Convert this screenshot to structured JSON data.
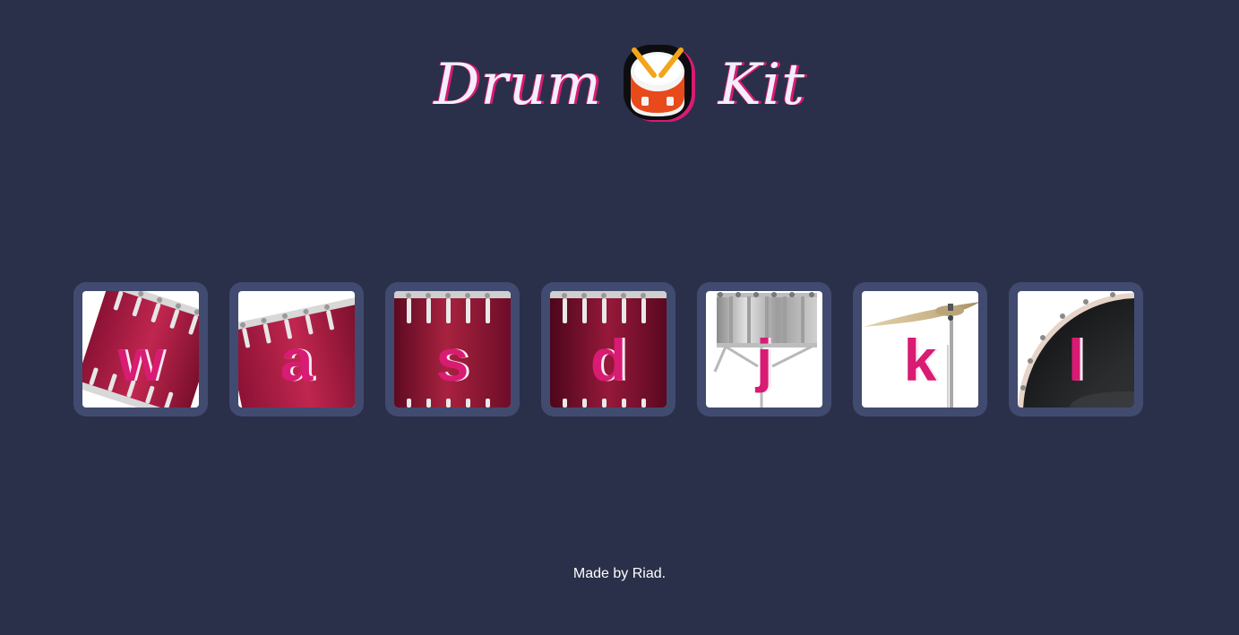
{
  "title": {
    "left_word": "Drum",
    "right_word": "Kit",
    "emoji_icon": "drum-icon"
  },
  "pads": [
    {
      "key": "w",
      "instrument_icon": "tom-1-icon"
    },
    {
      "key": "a",
      "instrument_icon": "tom-2-icon"
    },
    {
      "key": "s",
      "instrument_icon": "tom-3-icon"
    },
    {
      "key": "d",
      "instrument_icon": "tom-4-icon"
    },
    {
      "key": "j",
      "instrument_icon": "snare-icon"
    },
    {
      "key": "k",
      "instrument_icon": "crash-cymbal-icon"
    },
    {
      "key": "l",
      "instrument_icon": "kick-bass-icon"
    }
  ],
  "footer": {
    "text": "Made by Riad."
  },
  "colors": {
    "background": "#2a304a",
    "pad_frame": "#414b70",
    "key_text": "#d81b73",
    "drum_red": "#a3183f"
  }
}
